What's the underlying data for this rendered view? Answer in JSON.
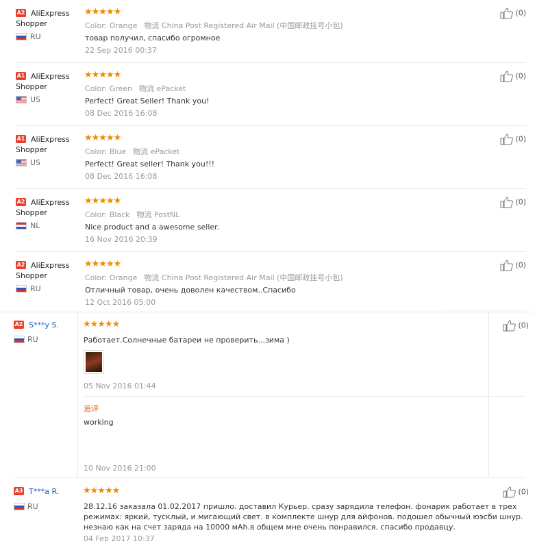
{
  "like_count_label": "(0)",
  "colors": {
    "badge": "#e8402b",
    "star": "#f28a00",
    "link_name": "#1d5fb8",
    "additional_title": "#e5621a"
  },
  "reviews": [
    {
      "badge": "A2",
      "user": "AliExpress Shopper",
      "country": "RU",
      "flag": "ru",
      "stars": 5,
      "color_key": "Color:",
      "color_value": "Orange",
      "shipping_key": "物流",
      "shipping_value": "China Post Registered Air Mail (中国邮政挂号小包)",
      "text": "товар получил, спасибо огромное",
      "date": "22 Sep 2016 00:37"
    },
    {
      "badge": "A1",
      "user": "AliExpress Shopper",
      "country": "US",
      "flag": "us",
      "stars": 5,
      "color_key": "Color:",
      "color_value": "Green",
      "shipping_key": "物流",
      "shipping_value": "ePacket",
      "text": "Perfect! Great Seller! Thank you!",
      "date": "08 Dec 2016 16:08"
    },
    {
      "badge": "A1",
      "user": "AliExpress Shopper",
      "country": "US",
      "flag": "us",
      "stars": 5,
      "color_key": "Color:",
      "color_value": "Blue",
      "shipping_key": "物流",
      "shipping_value": "ePacket",
      "text": "Perfect! Great seller! Thank you!!!",
      "date": "08 Dec 2016 16:08"
    },
    {
      "badge": "A2",
      "user": "AliExpress Shopper",
      "country": "NL",
      "flag": "nl",
      "stars": 5,
      "color_key": "Color:",
      "color_value": "Black",
      "shipping_key": "物流",
      "shipping_value": "PostNL",
      "text": "Nice product and a awesome seller.",
      "date": "16 Nov 2016 20:39"
    },
    {
      "badge": "A2",
      "user": "AliExpress Shopper",
      "country": "RU",
      "flag": "ru",
      "stars": 5,
      "color_key": "Color:",
      "color_value": "Orange",
      "shipping_key": "物流",
      "shipping_value": "China Post Registered Air Mail (中国邮政挂号小包)",
      "text": "Отличный товар, очень доволен качеством..Спасибо",
      "date": "12 Oct 2016 05:00"
    },
    {
      "badge": "A2",
      "user": "S***y S.",
      "country": "RU",
      "flag": "ru",
      "stars": 5,
      "text": "Работает.Солнечные батареи не проверить...зима )",
      "date": "05 Nov 2016 01:44",
      "additional_title": "追评",
      "additional_text": "working",
      "additional_date": "10 Nov 2016 21:00"
    },
    {
      "badge": "A3",
      "user": "T***a R.",
      "country": "RU",
      "flag": "ru",
      "stars": 5,
      "text": "28.12.16 заказала 01.02.2017 пришло. доставил Курьер. сразу зарядила телефон. фонарик работает в трех режимах: яркий, тусклый, и мигающий свет. в комплекте шнур для айфонов. подошел обычный юэсби шнур. незнаю как на счет заряда на 10000 мАh.в общем мне очень понравился. спасибо продавцу.",
      "date": "04 Feb 2017 10:37"
    }
  ]
}
